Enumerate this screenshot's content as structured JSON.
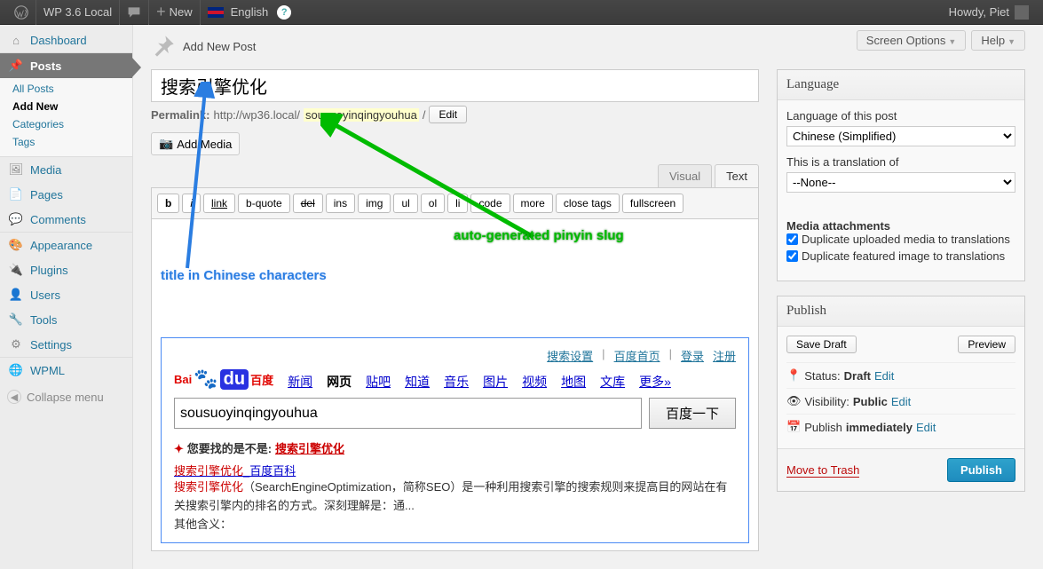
{
  "adminbar": {
    "site_title": "WP 3.6 Local",
    "new_label": "New",
    "lang_label": "English",
    "howdy": "Howdy, Piet"
  },
  "menu": {
    "dashboard": "Dashboard",
    "posts": "Posts",
    "posts_sub": {
      "all": "All Posts",
      "add": "Add New",
      "cats": "Categories",
      "tags": "Tags"
    },
    "media": "Media",
    "pages": "Pages",
    "comments": "Comments",
    "appearance": "Appearance",
    "plugins": "Plugins",
    "users": "Users",
    "tools": "Tools",
    "settings": "Settings",
    "wpml": "WPML",
    "collapse": "Collapse menu"
  },
  "toptools": {
    "screen_options": "Screen Options",
    "help": "Help"
  },
  "page_title": "Add New Post",
  "post": {
    "title_value": "搜索引擎优化",
    "permalink_label": "Permalink:",
    "permalink_base": "http://wp36.local/",
    "permalink_slug": "sousuoyinqingyouhua",
    "permalink_suffix": "/",
    "edit_btn": "Edit",
    "add_media_btn": "Add Media",
    "tabs": {
      "visual": "Visual",
      "text": "Text"
    },
    "toolbar": [
      "b",
      "i",
      "link",
      "b-quote",
      "del",
      "ins",
      "img",
      "ul",
      "ol",
      "li",
      "code",
      "more",
      "close tags",
      "fullscreen"
    ]
  },
  "annot": {
    "title": "title in Chinese characters",
    "slug": "auto-generated pinyin slug"
  },
  "baidu": {
    "top_links": [
      "搜索设置",
      "百度首页",
      "登录",
      "注册"
    ],
    "nav": [
      "新闻",
      "网页",
      "贴吧",
      "知道",
      "音乐",
      "图片",
      "视频",
      "地图",
      "文库",
      "更多»"
    ],
    "nav_active_index": 1,
    "query": "sousuoyinqingyouhua",
    "search_btn": "百度一下",
    "didyoumean_prefix": "您要找的是不是:",
    "didyoumean_term": "搜索引擎优化",
    "result_title_red": "搜索引擎优化",
    "result_title_rest": "_百度百科",
    "result_desc_red": "搜索引擎优化",
    "result_desc": "（SearchEngineOptimization，简称SEO）是一种利用搜索引擎的搜索规则来提高目的网站在有关搜索引擎内的排名的方式。深刻理解是：通...",
    "result_other": "其他含义："
  },
  "sidebar": {
    "language": {
      "box_title": "Language",
      "lang_of_post": "Language of this post",
      "lang_selected": "Chinese (Simplified)",
      "translation_of": "This is a translation of",
      "translation_selected": "--None--",
      "media_heading": "Media attachments",
      "dup_uploaded": "Duplicate uploaded media to translations",
      "dup_featured": "Duplicate featured image to translations"
    },
    "publish": {
      "box_title": "Publish",
      "save_draft": "Save Draft",
      "preview": "Preview",
      "status_label": "Status:",
      "status_value": "Draft",
      "visibility_label": "Visibility:",
      "visibility_value": "Public",
      "publish_label": "Publish",
      "publish_value": "immediately",
      "edit": "Edit",
      "trash": "Move to Trash",
      "publish_btn": "Publish"
    }
  }
}
